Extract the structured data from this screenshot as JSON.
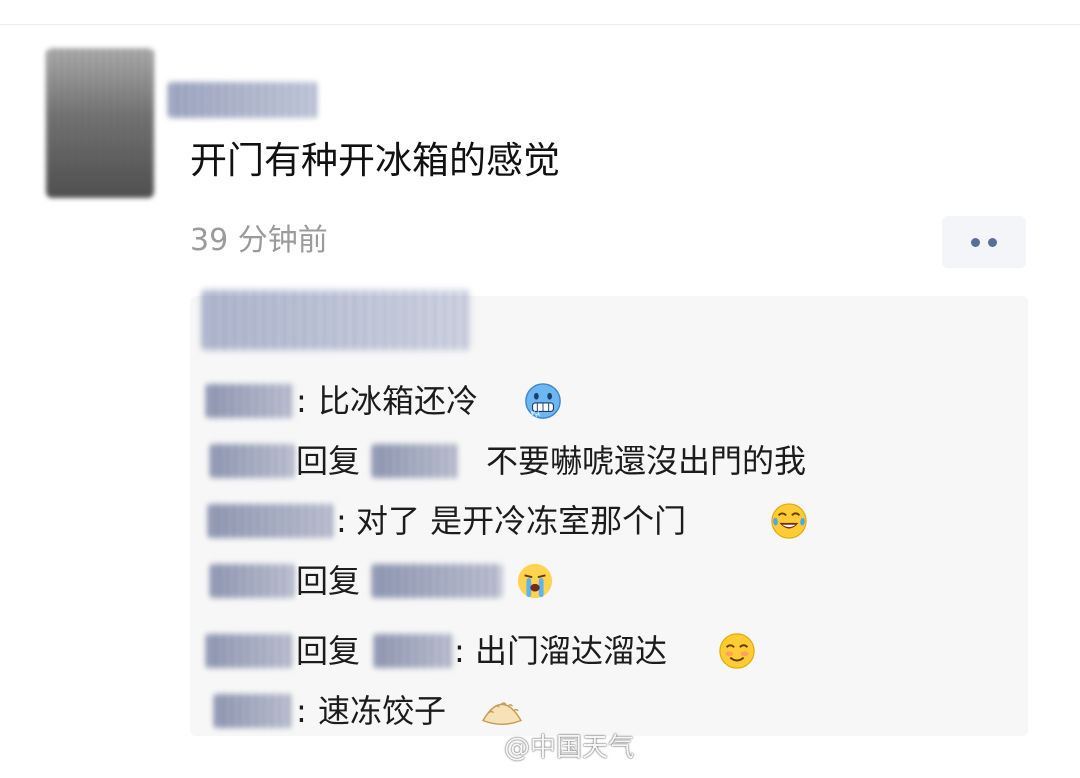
{
  "post": {
    "text": "开门有种开冰箱的感觉",
    "timestamp": "39 分钟前"
  },
  "comments": [
    {
      "prefix": ": ",
      "text": "比冰箱还冷",
      "emoji": "freezing-face"
    },
    {
      "prefix": "回复",
      "text": "不要嚇唬還沒出門的我",
      "emoji": ""
    },
    {
      "prefix": ": ",
      "text": "对了 是开冷冻室那个门",
      "emoji": "tears-of-joy-face"
    },
    {
      "prefix": "回复",
      "text": "",
      "emoji": "crying-face"
    },
    {
      "prefix": "回复",
      "text": ": 出门溜达溜达",
      "emoji": "smiling-face"
    },
    {
      "prefix": ": ",
      "text": "速冻饺子",
      "emoji": "dumpling"
    }
  ],
  "watermark": {
    "text": "@中国天气",
    "icon": "weibo-icon"
  },
  "colors": {
    "panel_bg": "#f7f7f7",
    "timestamp": "#9b9b9b",
    "more_dots": "#5a6f95"
  }
}
